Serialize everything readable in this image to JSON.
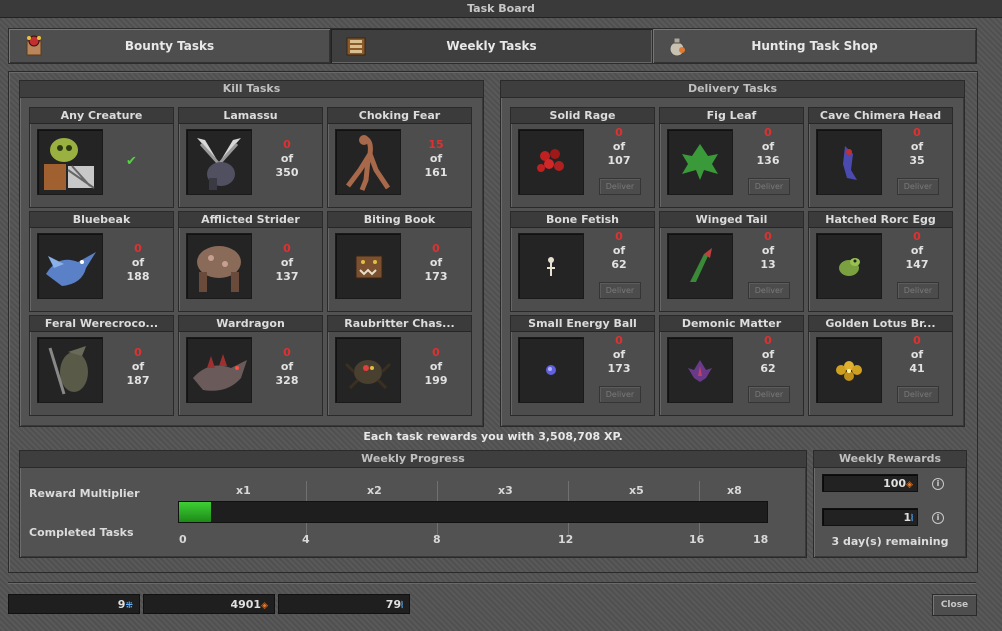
{
  "window": {
    "title": "Task Board"
  },
  "tabs": [
    {
      "label": "Bounty Tasks",
      "icon": "bounty-board-icon",
      "active": false
    },
    {
      "label": "Weekly Tasks",
      "icon": "scroll-book-icon",
      "active": true
    },
    {
      "label": "Hunting Task Shop",
      "icon": "pouch-icon",
      "active": false
    }
  ],
  "kill": {
    "title": "Kill Tasks",
    "tasks": [
      {
        "name": "Any Creature",
        "current": "",
        "of": "",
        "total": "",
        "done": true
      },
      {
        "name": "Lamassu",
        "current": "0",
        "of": "of",
        "total": "350"
      },
      {
        "name": "Choking Fear",
        "current": "15",
        "of": "of",
        "total": "161"
      },
      {
        "name": "Bluebeak",
        "current": "0",
        "of": "of",
        "total": "188"
      },
      {
        "name": "Afflicted Strider",
        "current": "0",
        "of": "of",
        "total": "137"
      },
      {
        "name": "Biting Book",
        "current": "0",
        "of": "of",
        "total": "173"
      },
      {
        "name": "Feral Werecroco...",
        "current": "0",
        "of": "of",
        "total": "187"
      },
      {
        "name": "Wardragon",
        "current": "0",
        "of": "of",
        "total": "328"
      },
      {
        "name": "Raubritter Chas...",
        "current": "0",
        "of": "of",
        "total": "199"
      }
    ]
  },
  "delivery": {
    "title": "Delivery Tasks",
    "deliver_label": "Deliver",
    "tasks": [
      {
        "name": "Solid Rage",
        "current": "0",
        "of": "of",
        "total": "107"
      },
      {
        "name": "Fig Leaf",
        "current": "0",
        "of": "of",
        "total": "136"
      },
      {
        "name": "Cave Chimera Head",
        "current": "0",
        "of": "of",
        "total": "35"
      },
      {
        "name": "Bone Fetish",
        "current": "0",
        "of": "of",
        "total": "62"
      },
      {
        "name": "Winged Tail",
        "current": "0",
        "of": "of",
        "total": "13"
      },
      {
        "name": "Hatched Rorc Egg",
        "current": "0",
        "of": "of",
        "total": "147"
      },
      {
        "name": "Small Energy Ball",
        "current": "0",
        "of": "of",
        "total": "173"
      },
      {
        "name": "Demonic Matter",
        "current": "0",
        "of": "of",
        "total": "62"
      },
      {
        "name": "Golden Lotus Br...",
        "current": "0",
        "of": "of",
        "total": "41"
      }
    ]
  },
  "reward_text": "Each task rewards you with 3,508,708 XP.",
  "progress": {
    "title": "Weekly Progress",
    "multiplier_label": "Reward Multiplier",
    "completed_label": "Completed Tasks",
    "multipliers": [
      "x1",
      "x2",
      "x3",
      "x5",
      "x8"
    ],
    "ticks": [
      "0",
      "4",
      "8",
      "12",
      "16",
      "18"
    ],
    "completed_fraction": 0.055
  },
  "weekly_rewards": {
    "title": "Weekly Rewards",
    "points": "100",
    "soulseals": "1",
    "remaining": "3 day(s) remaining"
  },
  "bottom": {
    "field1": "9",
    "field2": "4901",
    "field3": "79",
    "close_label": "Close"
  }
}
